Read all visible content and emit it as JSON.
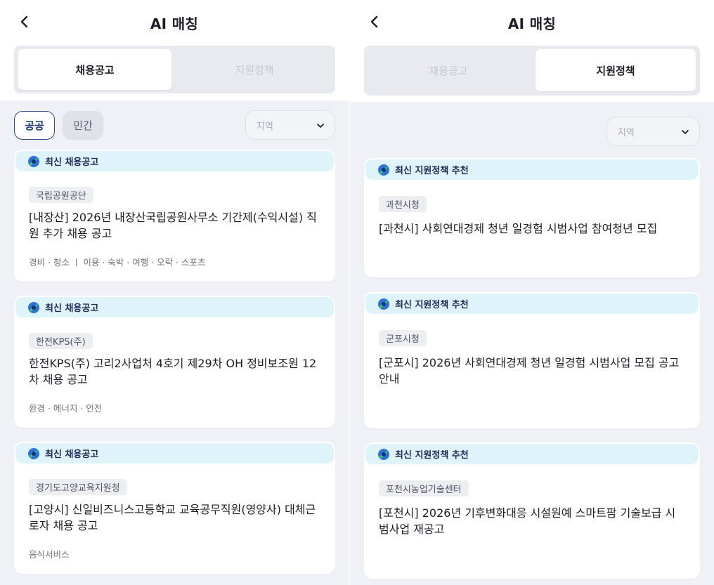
{
  "left": {
    "title": "AI 매칭",
    "tabs": [
      "채용공고",
      "지원정책"
    ],
    "chips": [
      "공공",
      "민간"
    ],
    "region_placeholder": "지역",
    "cards": [
      {
        "banner": "최신 채용공고",
        "org": "국립공원공단",
        "title": "[내장산] 2026년 내장산국립공원사무소 기간제(수익시설) 직원 추가 채용 공고",
        "meta": "경비 · 청소 ㅣ 이용 · 숙박 · 여행 · 오락 · 스포츠"
      },
      {
        "banner": "최신 채용공고",
        "org": "한전KPS(주)",
        "title": "한전KPS(주) 고리2사업처 4호기 제29차 OH 정비보조원 12차 채용 공고",
        "meta": "환경 · 에너지 · 안전"
      },
      {
        "banner": "최신 채용공고",
        "org": "경기도고양교육지원청",
        "title": "[고양시] 신일비즈니스고등학교 교육공무직원(영양사) 대체근로자 채용 공고",
        "meta": "음식서비스"
      }
    ]
  },
  "right": {
    "title": "AI 매칭",
    "tabs": [
      "채용공고",
      "지원정책"
    ],
    "region_placeholder": "지역",
    "cards": [
      {
        "banner": "최신 지원정책 추천",
        "org": "과천시청",
        "title": "[과천시] 사회연대경제 청년 일경험 시범사업 참여청년 모집"
      },
      {
        "banner": "최신 지원정책 추천",
        "org": "군포시청",
        "title": "[군포시] 2026년 사회연대경제 청년 일경험 시범사업 모집 공고 안내"
      },
      {
        "banner": "최신 지원정책 추천",
        "org": "포천시농업기술센터",
        "title": "[포천시] 2026년 기후변화대응 시설원예 스마트팜 기술보급 시범사업 재공고"
      }
    ]
  },
  "icons": {
    "back": "chevron-left-icon",
    "dropdown": "chevron-down-icon",
    "banner": "badge-logo-icon"
  },
  "colors": {
    "background": "#eff1f6",
    "banner": "#dff3fb",
    "chip_active_border": "#2f4a8c",
    "logo_blue": "#2f6fd8",
    "logo_green": "#34c96a"
  }
}
